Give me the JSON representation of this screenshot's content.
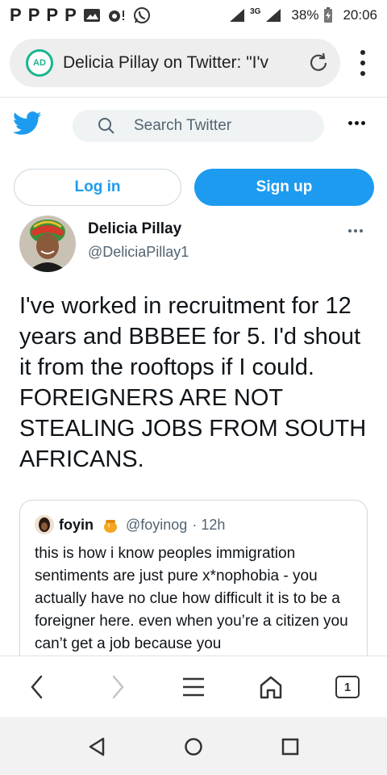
{
  "status_bar": {
    "notification_icons": [
      "P",
      "P",
      "P",
      "P"
    ],
    "network": "3G",
    "battery": "38%",
    "time": "20:06"
  },
  "address_bar": {
    "badge": "AD",
    "title": "Delicia Pillay on Twitter: \"I'v"
  },
  "twitter": {
    "search_placeholder": "Search Twitter",
    "login_label": "Log in",
    "signup_label": "Sign up",
    "accent": "#1d9bf0"
  },
  "tweet": {
    "display_name": "Delicia Pillay",
    "handle": "@DeliciaPillay1",
    "text": "I've worked in recruitment for 12 years and BBBEE for 5. I'd shout it from the rooftops if I could. FOREIGNERS ARE NOT STEALING JOBS FROM SOUTH AFRICANS.",
    "quoted": {
      "name": "foyin",
      "handle": "@foyinog",
      "time": "· 12h",
      "text": "this is how i know peoples immigration sentiments are just pure x*nophobia - you actually have no clue how difficult it is to be a foreigner here. even when you’re a citizen you can’t get a job because you"
    }
  },
  "browser_toolbar": {
    "tab_count": "1"
  }
}
